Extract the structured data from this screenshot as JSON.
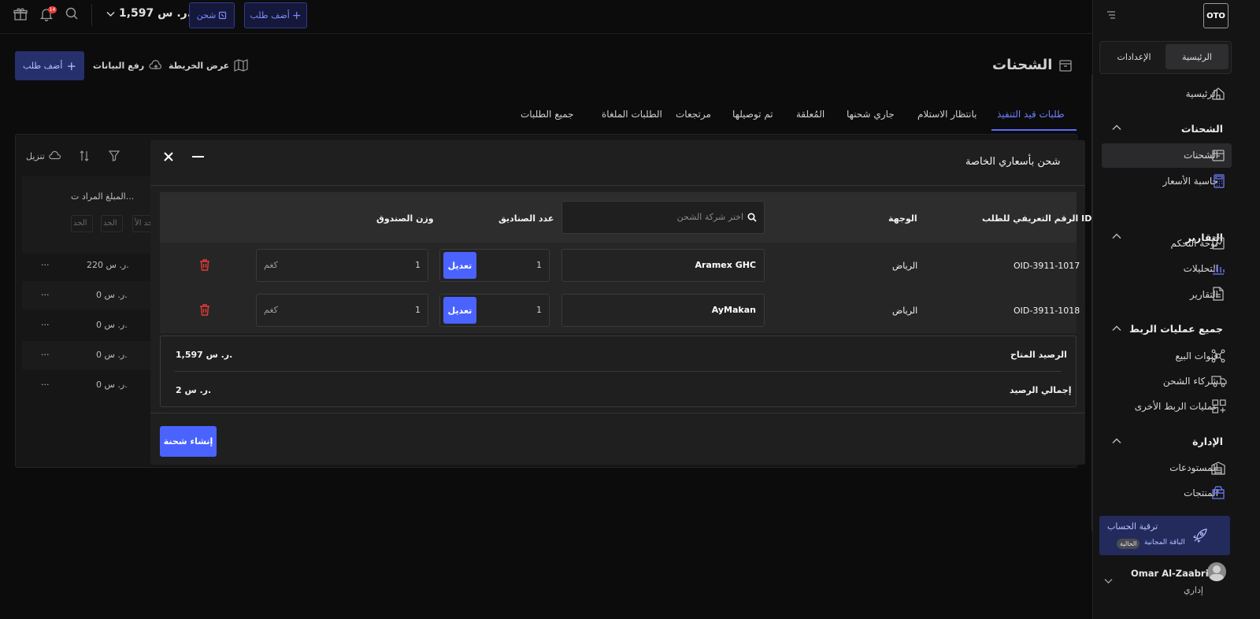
{
  "topbar": {
    "notif_count": "14",
    "balance": "1,597 ر. س.",
    "ship_label": "شحن",
    "add_order_label": "أضف طلب"
  },
  "sidebar": {
    "logo": "OTO",
    "tabs": {
      "home": "الرئيسية",
      "settings": "الإعدادات"
    },
    "home_item": "الرئيسية",
    "sections": [
      {
        "title": "الشحنات",
        "items": [
          "الشحنات",
          "حاسبة الأسعار"
        ]
      },
      {
        "title": "التقارير",
        "items": [
          "لوحة التحكم",
          "التحليلات",
          "التقارير"
        ]
      },
      {
        "title": "جميع عمليات الربط",
        "items": [
          "قنوات البيع",
          "شركاء الشحن",
          "عمليات الربط الأخرى"
        ]
      },
      {
        "title": "الإدارة",
        "items": [
          "المستودعات",
          "المنتجات"
        ]
      }
    ],
    "upgrade": {
      "title": "ترقية الحساب",
      "plan": "الباقة المجانية",
      "badge": "الحالية"
    },
    "user": {
      "name": "Omar Al-Zaabri",
      "role": "إداري"
    }
  },
  "page": {
    "title": "الشحنات",
    "map_view": "عرض الخريطة",
    "upload": "رفع البيانات",
    "add_order": "أضف طلب",
    "tabs": [
      "طلبات قيد التنفيذ",
      "بانتظار الاستلام",
      "جاري شحنها",
      "المُعلقة",
      "تم توصيلها",
      "مرتجعات",
      "الطلبات الملغاة",
      "جميع الطلبات"
    ]
  },
  "background_table": {
    "download": "تنزيل",
    "amount_header": "المبلغ المراد ت...",
    "min_labels": [
      "الحد",
      "الحد",
      "الحد الأ"
    ],
    "rows": [
      "220 ر. س.",
      "0 ر. س.",
      "0 ر. س.",
      "0 ر. س.",
      "0 ر. س."
    ],
    "more": "···"
  },
  "modal": {
    "title": "شحن بأسعاري الخاصة",
    "headers": {
      "order_id": "الرقم التعريفي للطلب ID",
      "destination": "الوجهة",
      "boxes": "عدد الصناديق",
      "weight": "وزن الصندوق"
    },
    "carrier_placeholder": "اختر شركة الشحن",
    "rows": [
      {
        "order_id": "OID-3911-1017",
        "destination": "الرياض",
        "carrier": "Aramex GHC",
        "boxes": "1",
        "edit": "تعديل",
        "weight": "1",
        "unit": "كغم"
      },
      {
        "order_id": "OID-3911-1018",
        "destination": "الرياض",
        "carrier": "AyMakan",
        "boxes": "1",
        "edit": "تعديل",
        "weight": "1",
        "unit": "كغم"
      }
    ],
    "summary": {
      "available_label": "الرصيد المتاح",
      "available_value": "1,597 ر. س.",
      "total_label": "إجمالي الرصيد",
      "total_value": "2 ر. س."
    },
    "create_button": "إنشاء شحنة"
  }
}
